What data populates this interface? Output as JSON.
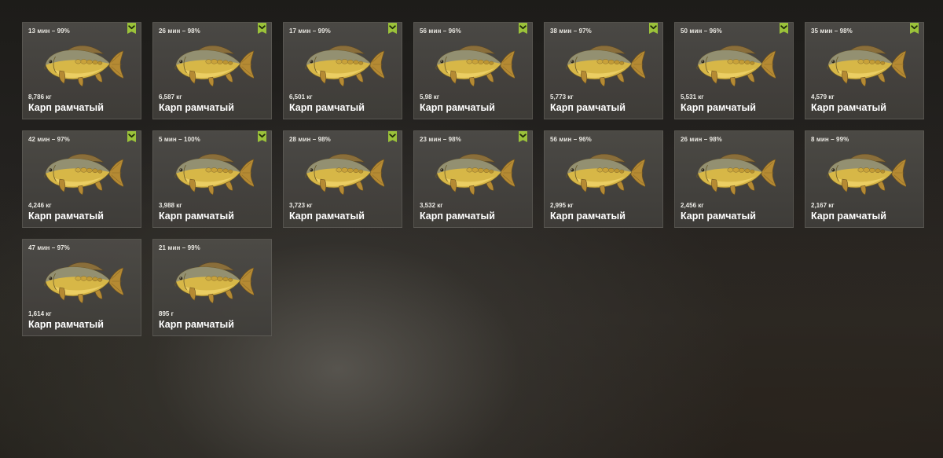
{
  "colors": {
    "accent": "#9bc23a",
    "card_background": "#4a4844",
    "fish_body": "#d9b94a",
    "fish_back": "#8c8a72"
  },
  "fish_icon": "mirror-carp-icon",
  "badge_icon": "check-badge-icon",
  "catches": [
    {
      "time": "13 мин – 99%",
      "weight": "8,786 кг",
      "name": "Карп рамчатый",
      "badge": true
    },
    {
      "time": "26 мин – 98%",
      "weight": "6,587 кг",
      "name": "Карп рамчатый",
      "badge": true
    },
    {
      "time": "17 мин – 99%",
      "weight": "6,501 кг",
      "name": "Карп рамчатый",
      "badge": true
    },
    {
      "time": "56 мин – 96%",
      "weight": "5,98 кг",
      "name": "Карп рамчатый",
      "badge": true
    },
    {
      "time": "38 мин – 97%",
      "weight": "5,773 кг",
      "name": "Карп рамчатый",
      "badge": true
    },
    {
      "time": "50 мин – 96%",
      "weight": "5,531 кг",
      "name": "Карп рамчатый",
      "badge": true
    },
    {
      "time": "35 мин – 98%",
      "weight": "4,579 кг",
      "name": "Карп рамчатый",
      "badge": true
    },
    {
      "time": "42 мин – 97%",
      "weight": "4,246 кг",
      "name": "Карп рамчатый",
      "badge": true
    },
    {
      "time": "5 мин – 100%",
      "weight": "3,988 кг",
      "name": "Карп рамчатый",
      "badge": true
    },
    {
      "time": "28 мин – 98%",
      "weight": "3,723 кг",
      "name": "Карп рамчатый",
      "badge": true
    },
    {
      "time": "23 мин – 98%",
      "weight": "3,532 кг",
      "name": "Карп рамчатый",
      "badge": true
    },
    {
      "time": "56 мин – 96%",
      "weight": "2,995 кг",
      "name": "Карп рамчатый",
      "badge": false
    },
    {
      "time": "26 мин – 98%",
      "weight": "2,456 кг",
      "name": "Карп рамчатый",
      "badge": false
    },
    {
      "time": "8 мин – 99%",
      "weight": "2,167 кг",
      "name": "Карп рамчатый",
      "badge": false
    },
    {
      "time": "47 мин – 97%",
      "weight": "1,614 кг",
      "name": "Карп рамчатый",
      "badge": false
    },
    {
      "time": "21 мин – 99%",
      "weight": "895 г",
      "name": "Карп рамчатый",
      "badge": false
    }
  ]
}
